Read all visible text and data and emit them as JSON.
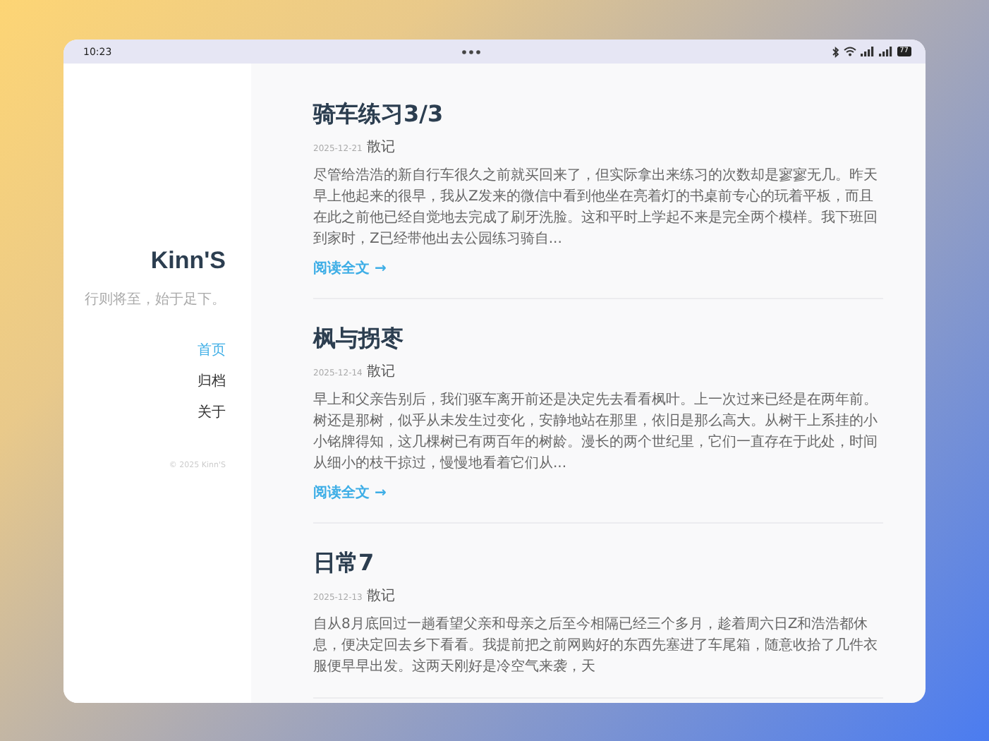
{
  "status_bar": {
    "time": "10:23",
    "battery": "77"
  },
  "sidebar": {
    "title": "Kinn'S",
    "subtitle": "行则将至，始于足下。",
    "nav": [
      {
        "label": "首页",
        "selected": true
      },
      {
        "label": "归档",
        "selected": false
      },
      {
        "label": "关于",
        "selected": false
      }
    ],
    "copyright": "© 2025 Kinn'S"
  },
  "posts": [
    {
      "title": "骑车练习3/3",
      "date": "2025-12-21",
      "category": "散记",
      "excerpt": "尽管给浩浩的新自行车很久之前就买回来了，但实际拿出来练习的次数却是寥寥无几。昨天早上他起来的很早，我从Z发来的微信中看到他坐在亮着灯的书桌前专心的玩着平板，而且在此之前他已经自觉地去完成了刷牙洗脸。这和平时上学起不来是完全两个模样。我下班回到家时，Z已经带他出去公园练习骑自...",
      "read_more": "阅读全文 →"
    },
    {
      "title": "枫与拐枣",
      "date": "2025-12-14",
      "category": "散记",
      "excerpt": "早上和父亲告别后，我们驱车离开前还是决定先去看看枫叶。上一次过来已经是在两年前。树还是那树，似乎从未发生过变化，安静地站在那里，依旧是那么高大。从树干上系挂的小小铭牌得知，这几棵树已有两百年的树龄。漫长的两个世纪里，它们一直存在于此处，时间从细小的枝干掠过，慢慢地看着它们从...",
      "read_more": "阅读全文 →"
    },
    {
      "title": "日常7",
      "date": "2025-12-13",
      "category": "散记",
      "excerpt": "自从8月底回过一趟看望父亲和母亲之后至今相隔已经三个多月，趁着周六日Z和浩浩都休息，便决定回去乡下看看。我提前把之前网购好的东西先塞进了车尾箱，随意收拾了几件衣服便早早出发。这两天刚好是冷空气来袭，天"
    }
  ]
}
